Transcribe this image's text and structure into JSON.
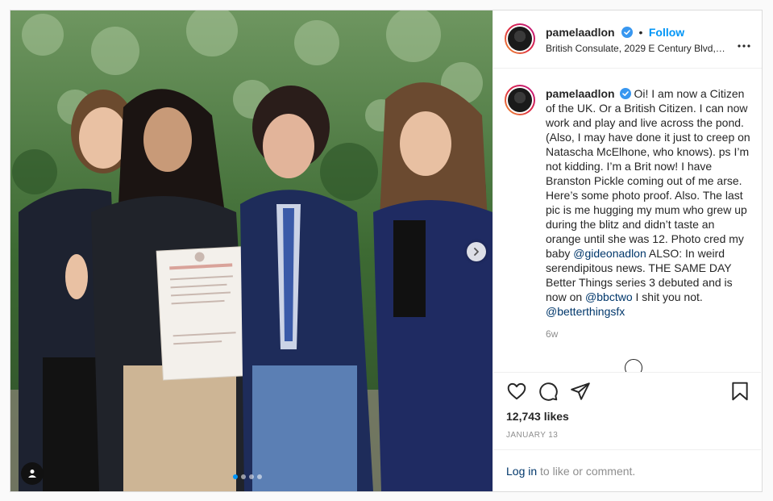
{
  "post": {
    "username": "pamelaadlon",
    "verified": true,
    "follow_label": "Follow",
    "separator": "•",
    "location": "British Consulate, 2029 E Century Blvd, Lo...",
    "more_icon": "more-horizontal-icon"
  },
  "media": {
    "carousel_dots": 4,
    "active_dot": 0,
    "next_icon": "chevron-right-icon",
    "tag_icon": "user-tag-icon"
  },
  "caption": {
    "username": "pamelaadlon",
    "part1": "Oi! I am now a Citizen of the UK. Or a British Citizen. I can now work and play and live across the pond. (Also, I may have done it just to creep on Natascha McElhone, who knows). ps I’m not kidding. I’m a Brit now! I have Branston Pickle coming out of me arse. Here’s some photo proof. Also. The last pic is me hugging my mum who grew up during the blitz and didn’t taste an orange until she was 12. Photo cred my baby ",
    "mention1": "@gideonadlon",
    "part2": " ALSO: In weird serendipitous news. THE SAME DAY Better Things series 3 debuted and is now on ",
    "mention2": "@bbctwo",
    "part3": " I shit you not. ",
    "mention3": "@betterthingsfx",
    "age": "6w"
  },
  "actions": {
    "like_icon": "heart-icon",
    "comment_icon": "comment-icon",
    "share_icon": "share-icon",
    "save_icon": "bookmark-icon",
    "likes": "12,743 likes",
    "date": "January 13"
  },
  "login": {
    "link": "Log in",
    "text": " to like or comment."
  },
  "colors": {
    "accent": "#0095f6",
    "mention": "#00376b",
    "muted": "#8e8e8e",
    "text": "#262626"
  }
}
